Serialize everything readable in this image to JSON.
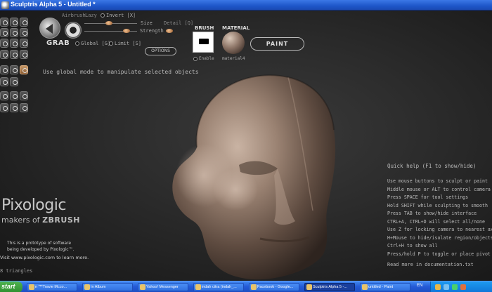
{
  "window": {
    "title": "Sculptris Alpha 5 - Untitled *"
  },
  "toolbar": {
    "grab_label": "GRAB",
    "airbrush_label": "Airbrush",
    "lazy_label": "Lazy",
    "invert_label": "Invert [X]",
    "size_label": "Size",
    "strength_label": "Strength",
    "detail_label": "Detail [Q]",
    "global_label": "Global [G]",
    "limit_label": "Limit [S]",
    "options_label": "OPTIONS",
    "brush_label": "BRUSH",
    "enable_label": "Enable",
    "material_label": "MATERIAL",
    "material_name": "material4",
    "paint_label": "PAINT"
  },
  "viewport": {
    "mode_hint": "Use global mode to manipulate selected objects",
    "triangles": "8 triangles"
  },
  "branding": {
    "logo": "Pixologic",
    "tagline_prefix": "makers of ",
    "tagline_brand": "ZBRUSH",
    "prototype_line1": "This is a prototype of software",
    "prototype_line2": "being developed by Pixologic™.",
    "visit": "Visit www.pixologic.com to learn more."
  },
  "quick_help": {
    "title": "Quick help (F1 to show/hide)",
    "items": [
      "Use mouse buttons to sculpt or paint",
      "Middle mouse or ALT to control camera",
      "Press SPACE for tool settings",
      "Hold SHIFT while sculpting to smooth",
      "Press TAB to show/hide interface",
      "CTRL+A, CTRL+D will select all/none",
      "Use Z for locking camera to nearest axis",
      "H+Mouse to hide/isolate region/objects",
      "Ctrl+H to show all",
      "Press/hold P to toggle or place pivot"
    ],
    "more": "Read more in documentation.txt"
  },
  "taskbar": {
    "start": "start",
    "tasks": [
      "n \"**Travie Mcco...",
      "In Album",
      "Yahoo! Messenger",
      "indah citra (indah_...",
      "Facebook - Google...",
      "Sculptris Alpha 5 -...",
      "untitled - Paint"
    ],
    "lang": "EN"
  },
  "colors": {
    "accent_knob": "#c8884a",
    "model_skin": "#8a7466",
    "taskbar_blue": "#2459d6",
    "start_green": "#3a9d3a"
  }
}
